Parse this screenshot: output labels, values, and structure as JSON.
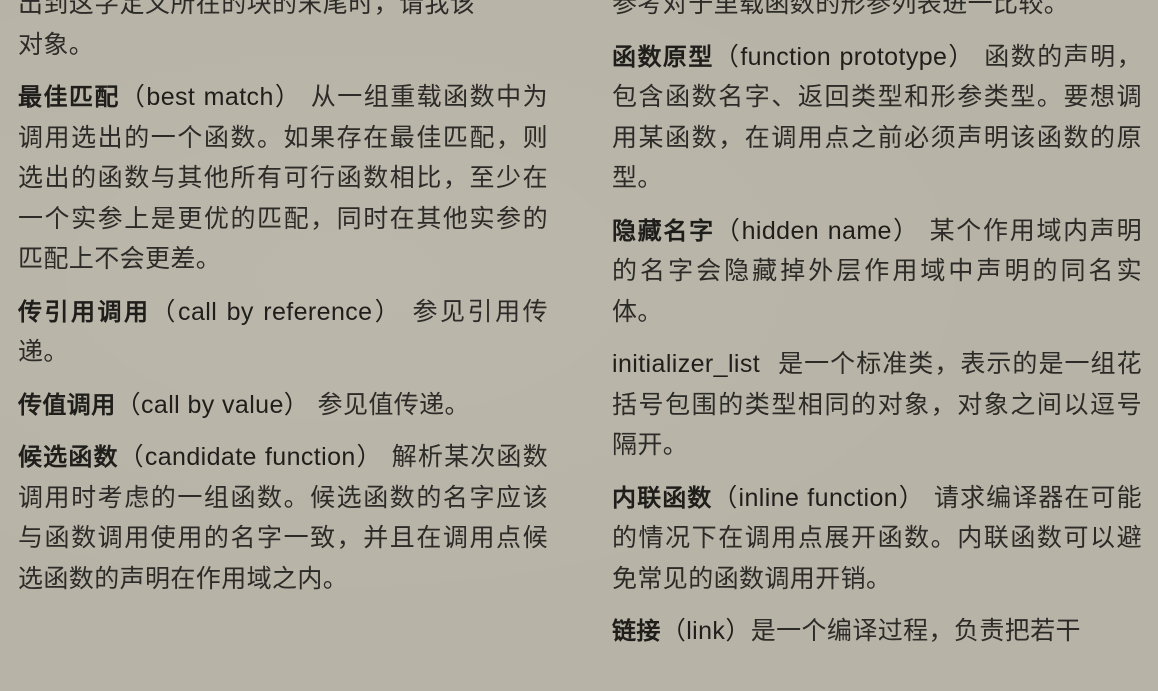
{
  "left": {
    "fragment_top": "出到这字定义所在的块的末尾时，请我该",
    "fragment_tail": "对象。",
    "entries": [
      {
        "term_zh": "最佳匹配",
        "term_en": "（best match）",
        "definition": "从一组重载函数中为调用选出的一个函数。如果存在最佳匹配，则选出的函数与其他所有可行函数相比，至少在一个实参上是更优的匹配，同时在其他实参的匹配上不会更差。"
      },
      {
        "term_zh": "传引用调用",
        "term_en": "（call by reference）",
        "definition": "参见引用传递。"
      },
      {
        "term_zh": "传值调用",
        "term_en": "（call by value）",
        "definition": "参见值传递。"
      },
      {
        "term_zh": "候选函数",
        "term_en": "（candidate function）",
        "definition": "解析某次函数调用时考虑的一组函数。候选函数的名字应该与函数调用使用的名字一致，并且在调用点候选函数的声明在作用域之内。"
      }
    ]
  },
  "right": {
    "fragment_top": "参考对于里载函数的形参列表进一比较。",
    "entries": [
      {
        "term_zh": "函数原型",
        "term_en": "（function prototype）",
        "definition": "函数的声明，包含函数名字、返回类型和形参类型。要想调用某函数，在调用点之前必须声明该函数的原型。"
      },
      {
        "term_zh": "隐藏名字",
        "term_en": "（hidden name）",
        "definition": "某个作用域内声明的名字会隐藏掉外层作用域中声明的同名实体。"
      },
      {
        "term_zh": "",
        "term_en": "initializer_list",
        "definition": "是一个标准类，表示的是一组花括号包围的类型相同的对象，对象之间以逗号隔开。"
      },
      {
        "term_zh": "内联函数",
        "term_en": "（inline function）",
        "definition": "请求编译器在可能的情况下在调用点展开函数。内联函数可以避免常见的函数调用开销。"
      },
      {
        "term_zh": "链接",
        "term_en": "（link）",
        "definition": "是一个编译过程，负责把若干"
      }
    ]
  }
}
